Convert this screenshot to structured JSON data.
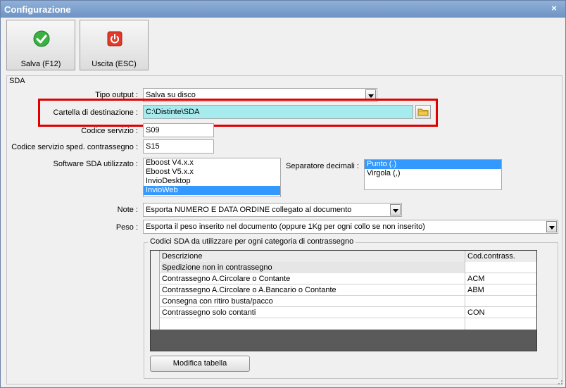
{
  "window": {
    "title": "Configurazione",
    "close_glyph": "×"
  },
  "toolbar": {
    "save_label": "Salva (F12)",
    "exit_label": "Uscita (ESC)",
    "save_icon": "checkmark-icon",
    "exit_icon": "power-icon"
  },
  "sda": {
    "legend": "SDA",
    "tipo_output": {
      "label": "Tipo output :",
      "value": "Salva su disco"
    },
    "cartella": {
      "label": "Cartella di destinazione :",
      "value": "C:\\Distinte\\SDA"
    },
    "codice_servizio": {
      "label": "Codice servizio :",
      "value": "S09"
    },
    "codice_contrassegno": {
      "label": "Codice servizio sped. contrassegno :",
      "value": "S15"
    },
    "software": {
      "label": "Software SDA utilizzato :",
      "options": [
        "Eboost V4.x.x",
        "Eboost V5.x.x",
        "InvioDesktop",
        "InvioWeb"
      ],
      "selected_index": 3
    },
    "separatore": {
      "label": "Separatore decimali :",
      "options": [
        "Punto (.)",
        "Virgola (,)"
      ],
      "selected_index": 0
    },
    "note": {
      "label": "Note :",
      "value": "Esporta NUMERO E DATA ORDINE collegato al documento"
    },
    "peso": {
      "label": "Peso :",
      "value": "Esporta il peso inserito nel documento (oppure 1Kg per ogni collo se non inserito)"
    },
    "codici": {
      "legend": "Codici SDA da utilizzare per ogni categoria di contrassegno",
      "columns": [
        "Descrizione",
        "Cod.contrass."
      ],
      "rows": [
        [
          "Spedizione non in contrassegno",
          ""
        ],
        [
          "Contrassegno A.Circolare o Contante",
          "ACM"
        ],
        [
          "Contrassegno A.Circolare o A.Bancario o Contante",
          "ABM"
        ],
        [
          "Consegna con ritiro busta/pacco",
          ""
        ],
        [
          "Contrassegno solo contanti",
          "CON"
        ]
      ],
      "modify_label": "Modifica tabella"
    }
  },
  "colors": {
    "highlight": "#e00000",
    "selection": "#3399ff",
    "field_highlight": "#a6ecef"
  }
}
